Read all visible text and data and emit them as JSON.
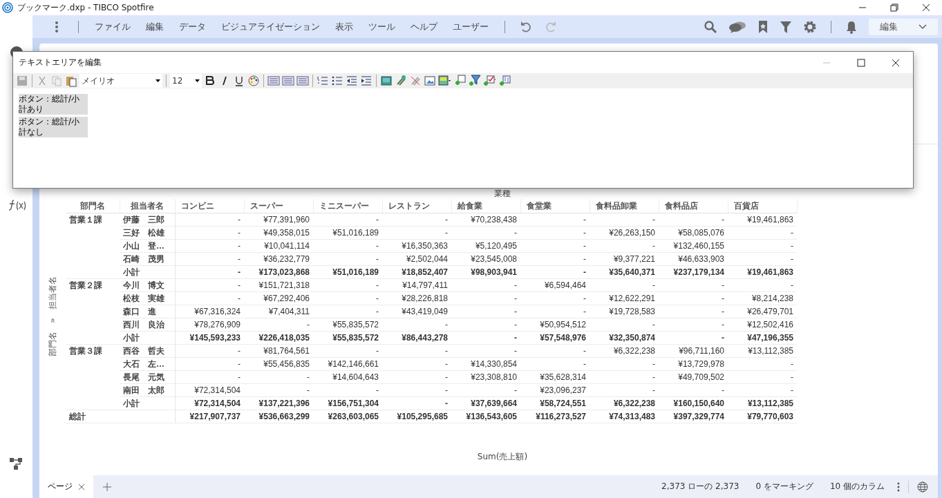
{
  "window": {
    "title": "ブックマーク.dxp - TIBCO Spotfire"
  },
  "menu": {
    "items": [
      "ファイル",
      "編集",
      "データ",
      "ビジュアライゼーション",
      "表示",
      "ツール",
      "ヘルプ",
      "ユーザー"
    ],
    "mode": "編集"
  },
  "dialog": {
    "title": "テキストエリアを編集",
    "font": "メイリオ",
    "size": "12",
    "blocks": [
      "ボタン：総計/小計あり",
      "ボタン：総計/小計なし"
    ]
  },
  "table": {
    "category_header": "業種",
    "axis_label": "部門名　»　担当者名",
    "value_axis": "Sum(売上額)",
    "columns": [
      "部門名",
      "担当者名",
      "コンビニ",
      "スーパー",
      "ミニスーパー",
      "レストラン",
      "給食業",
      "食堂業",
      "食料品卸業",
      "食料品店",
      "百貨店"
    ],
    "groups": [
      {
        "dept": "営業１課",
        "rows": [
          {
            "kind": "detail",
            "name": "伊藤　三郎",
            "values": [
              "-",
              "¥77,391,960",
              "-",
              "-",
              "¥70,238,438",
              "-",
              "-",
              "-",
              "¥19,461,863"
            ]
          },
          {
            "kind": "detail",
            "name": "三好　松雄",
            "values": [
              "-",
              "¥49,358,015",
              "¥51,016,189",
              "-",
              "-",
              "-",
              "¥26,263,150",
              "¥58,085,076",
              "-"
            ]
          },
          {
            "kind": "detail",
            "name": "小山　登…",
            "values": [
              "-",
              "¥10,041,114",
              "-",
              "¥16,350,363",
              "¥5,120,495",
              "-",
              "-",
              "¥132,460,155",
              "-"
            ]
          },
          {
            "kind": "detail",
            "name": "石崎　茂男",
            "values": [
              "-",
              "¥36,232,779",
              "-",
              "¥2,502,044",
              "¥23,545,008",
              "-",
              "¥9,377,221",
              "¥46,633,903",
              "-"
            ]
          },
          {
            "kind": "subtotal",
            "name": "小計",
            "values": [
              "-",
              "¥173,023,868",
              "¥51,016,189",
              "¥18,852,407",
              "¥98,903,941",
              "-",
              "¥35,640,371",
              "¥237,179,134",
              "¥19,461,863"
            ]
          }
        ]
      },
      {
        "dept": "営業２課",
        "rows": [
          {
            "kind": "detail",
            "name": "今川　博文",
            "values": [
              "-",
              "¥151,721,318",
              "-",
              "¥14,797,411",
              "-",
              "¥6,594,464",
              "-",
              "-",
              "-"
            ]
          },
          {
            "kind": "detail",
            "name": "松枝　実雄",
            "values": [
              "-",
              "¥67,292,406",
              "-",
              "¥28,226,818",
              "-",
              "-",
              "¥12,622,291",
              "-",
              "¥8,214,238"
            ]
          },
          {
            "kind": "detail",
            "name": "森口　進",
            "values": [
              "¥67,316,324",
              "¥7,404,311",
              "-",
              "¥43,419,049",
              "-",
              "-",
              "¥19,728,583",
              "-",
              "¥26,479,701"
            ]
          },
          {
            "kind": "detail",
            "name": "西川　良治",
            "values": [
              "¥78,276,909",
              "-",
              "¥55,835,572",
              "-",
              "-",
              "¥50,954,512",
              "-",
              "-",
              "¥12,502,416"
            ]
          },
          {
            "kind": "subtotal",
            "name": "小計",
            "values": [
              "¥145,593,233",
              "¥226,418,035",
              "¥55,835,572",
              "¥86,443,278",
              "-",
              "¥57,548,976",
              "¥32,350,874",
              "-",
              "¥47,196,355"
            ]
          }
        ]
      },
      {
        "dept": "営業３課",
        "rows": [
          {
            "kind": "detail",
            "name": "西谷　哲夫",
            "values": [
              "-",
              "¥81,764,561",
              "-",
              "-",
              "-",
              "-",
              "¥6,322,238",
              "¥96,711,160",
              "¥13,112,385"
            ]
          },
          {
            "kind": "detail",
            "name": "大石　左…",
            "values": [
              "-",
              "¥55,456,835",
              "¥142,146,661",
              "-",
              "¥14,330,854",
              "-",
              "-",
              "¥13,729,978",
              "-"
            ]
          },
          {
            "kind": "detail",
            "name": "長尾　元気",
            "values": [
              "-",
              "-",
              "¥14,604,643",
              "-",
              "¥23,308,810",
              "¥35,628,314",
              "-",
              "¥49,709,502",
              "-"
            ]
          },
          {
            "kind": "detail",
            "name": "南田　太郎",
            "values": [
              "¥72,314,504",
              "-",
              "-",
              "-",
              "-",
              "¥23,096,237",
              "-",
              "-",
              "-"
            ]
          },
          {
            "kind": "subtotal",
            "name": "小計",
            "values": [
              "¥72,314,504",
              "¥137,221,396",
              "¥156,751,304",
              "-",
              "¥37,639,664",
              "¥58,724,551",
              "¥6,322,238",
              "¥160,150,640",
              "¥13,112,385"
            ]
          }
        ]
      }
    ],
    "grand_total": {
      "label": "総計",
      "values": [
        "¥217,907,737",
        "¥536,663,299",
        "¥263,603,065",
        "¥105,295,685",
        "¥136,543,605",
        "¥116,273,527",
        "¥74,313,483",
        "¥397,329,774",
        "¥79,770,603"
      ]
    }
  },
  "status_bar": {
    "page_tab": "ページ",
    "rows": "2,373 ローの 2,373",
    "marked": "0 をマーキング",
    "columns": "10 個のカラム"
  }
}
